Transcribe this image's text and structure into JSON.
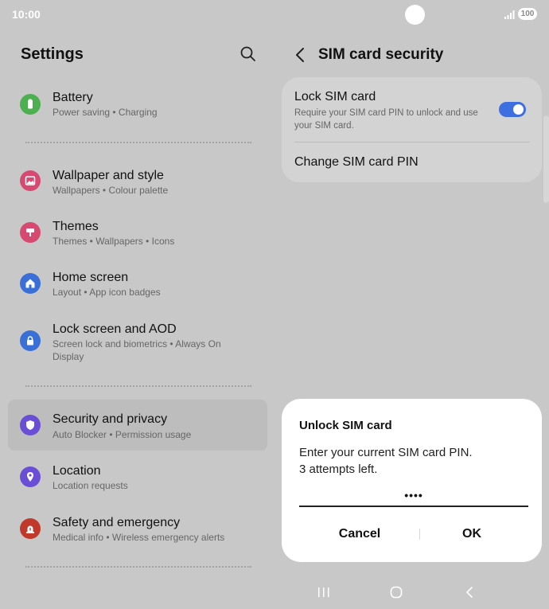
{
  "status_bar": {
    "time": "10:00",
    "battery": "100"
  },
  "left_pane": {
    "title": "Settings",
    "items": [
      {
        "title": "Battery",
        "subtitle": "Power saving  •  Charging",
        "color": "#4caf50",
        "icon": "battery-icon"
      },
      {
        "title": "Wallpaper and style",
        "subtitle": "Wallpapers  •  Colour palette",
        "color": "#d64a72",
        "icon": "wallpaper-icon"
      },
      {
        "title": "Themes",
        "subtitle": "Themes  •  Wallpapers  •  Icons",
        "color": "#d64a72",
        "icon": "themes-icon"
      },
      {
        "title": "Home screen",
        "subtitle": "Layout  •  App icon badges",
        "color": "#3a6fd8",
        "icon": "home-icon"
      },
      {
        "title": "Lock screen and AOD",
        "subtitle": "Screen lock and biometrics  •  Always On Display",
        "color": "#3a6fd8",
        "icon": "lock-icon"
      },
      {
        "title": "Security and privacy",
        "subtitle": "Auto Blocker  •  Permission usage",
        "color": "#6a4fd6",
        "icon": "shield-icon"
      },
      {
        "title": "Location",
        "subtitle": "Location requests",
        "color": "#6a4fd6",
        "icon": "location-pin-icon"
      },
      {
        "title": "Safety and emergency",
        "subtitle": "Medical info  •  Wireless emergency alerts",
        "color": "#c0392b",
        "icon": "emergency-icon"
      }
    ]
  },
  "right_pane": {
    "title": "SIM card security",
    "lock_sim": {
      "title": "Lock SIM card",
      "subtitle": "Require your SIM card PIN to unlock and use your SIM card.",
      "enabled": true
    },
    "change_pin": "Change SIM card PIN"
  },
  "dialog": {
    "title": "Unlock SIM card",
    "message_line1": "Enter your current SIM card PIN.",
    "message_line2": "3 attempts left.",
    "pin_value": "••••",
    "cancel_label": "Cancel",
    "ok_label": "OK"
  },
  "colors": {
    "accent": "#3e6fe0",
    "background": "#c8c8c8",
    "card": "#d3d3d3"
  }
}
